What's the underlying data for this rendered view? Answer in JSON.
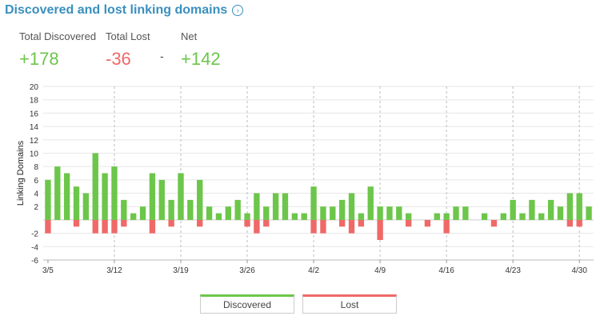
{
  "header": {
    "title": "Discovered and lost linking domains",
    "info_icon": "info-circle-icon"
  },
  "stats": {
    "discovered": {
      "label": "Total Discovered",
      "value": "+178"
    },
    "lost": {
      "label": "Total Lost",
      "value": "-36"
    },
    "separator": "-",
    "net": {
      "label": "Net",
      "value": "+142"
    }
  },
  "colors": {
    "discovered": "#6cc64a",
    "lost": "#f06868",
    "title": "#3a8fbf"
  },
  "legend": {
    "discovered": "Discovered",
    "lost": "Lost"
  },
  "chart_data": {
    "type": "bar",
    "ylabel": "Linking Domains",
    "ylim": [
      -6,
      20
    ],
    "yticks": [
      -6,
      -4,
      -2,
      2,
      4,
      6,
      8,
      10,
      12,
      14,
      16,
      18,
      20
    ],
    "xlabels": [
      "3/5",
      "3/12",
      "3/19",
      "3/26",
      "4/2",
      "4/9",
      "4/16",
      "4/23",
      "4/30"
    ],
    "series": [
      {
        "name": "Discovered",
        "values": [
          6,
          8,
          7,
          5,
          4,
          10,
          7,
          8,
          3,
          1,
          2,
          7,
          6,
          3,
          7,
          3,
          6,
          2,
          1,
          2,
          3,
          1,
          4,
          2,
          4,
          4,
          1,
          1,
          5,
          2,
          2,
          3,
          4,
          1,
          5,
          2,
          2,
          2,
          1,
          0,
          0,
          1,
          1,
          2,
          2,
          0,
          1,
          0,
          1,
          3,
          1,
          3,
          1,
          3,
          2,
          4,
          4,
          2
        ]
      },
      {
        "name": "Lost",
        "values": [
          -2,
          0,
          0,
          -1,
          0,
          -2,
          -2,
          -2,
          -1,
          0,
          0,
          -2,
          0,
          -1,
          0,
          0,
          -1,
          0,
          0,
          0,
          0,
          -1,
          -2,
          -1,
          0,
          0,
          0,
          0,
          -2,
          -2,
          0,
          -1,
          -2,
          -1,
          0,
          -3,
          0,
          0,
          -1,
          0,
          -1,
          0,
          -2,
          0,
          0,
          0,
          0,
          -1,
          0,
          0,
          0,
          0,
          0,
          0,
          0,
          -1,
          -1,
          0
        ]
      }
    ],
    "grid": true
  }
}
